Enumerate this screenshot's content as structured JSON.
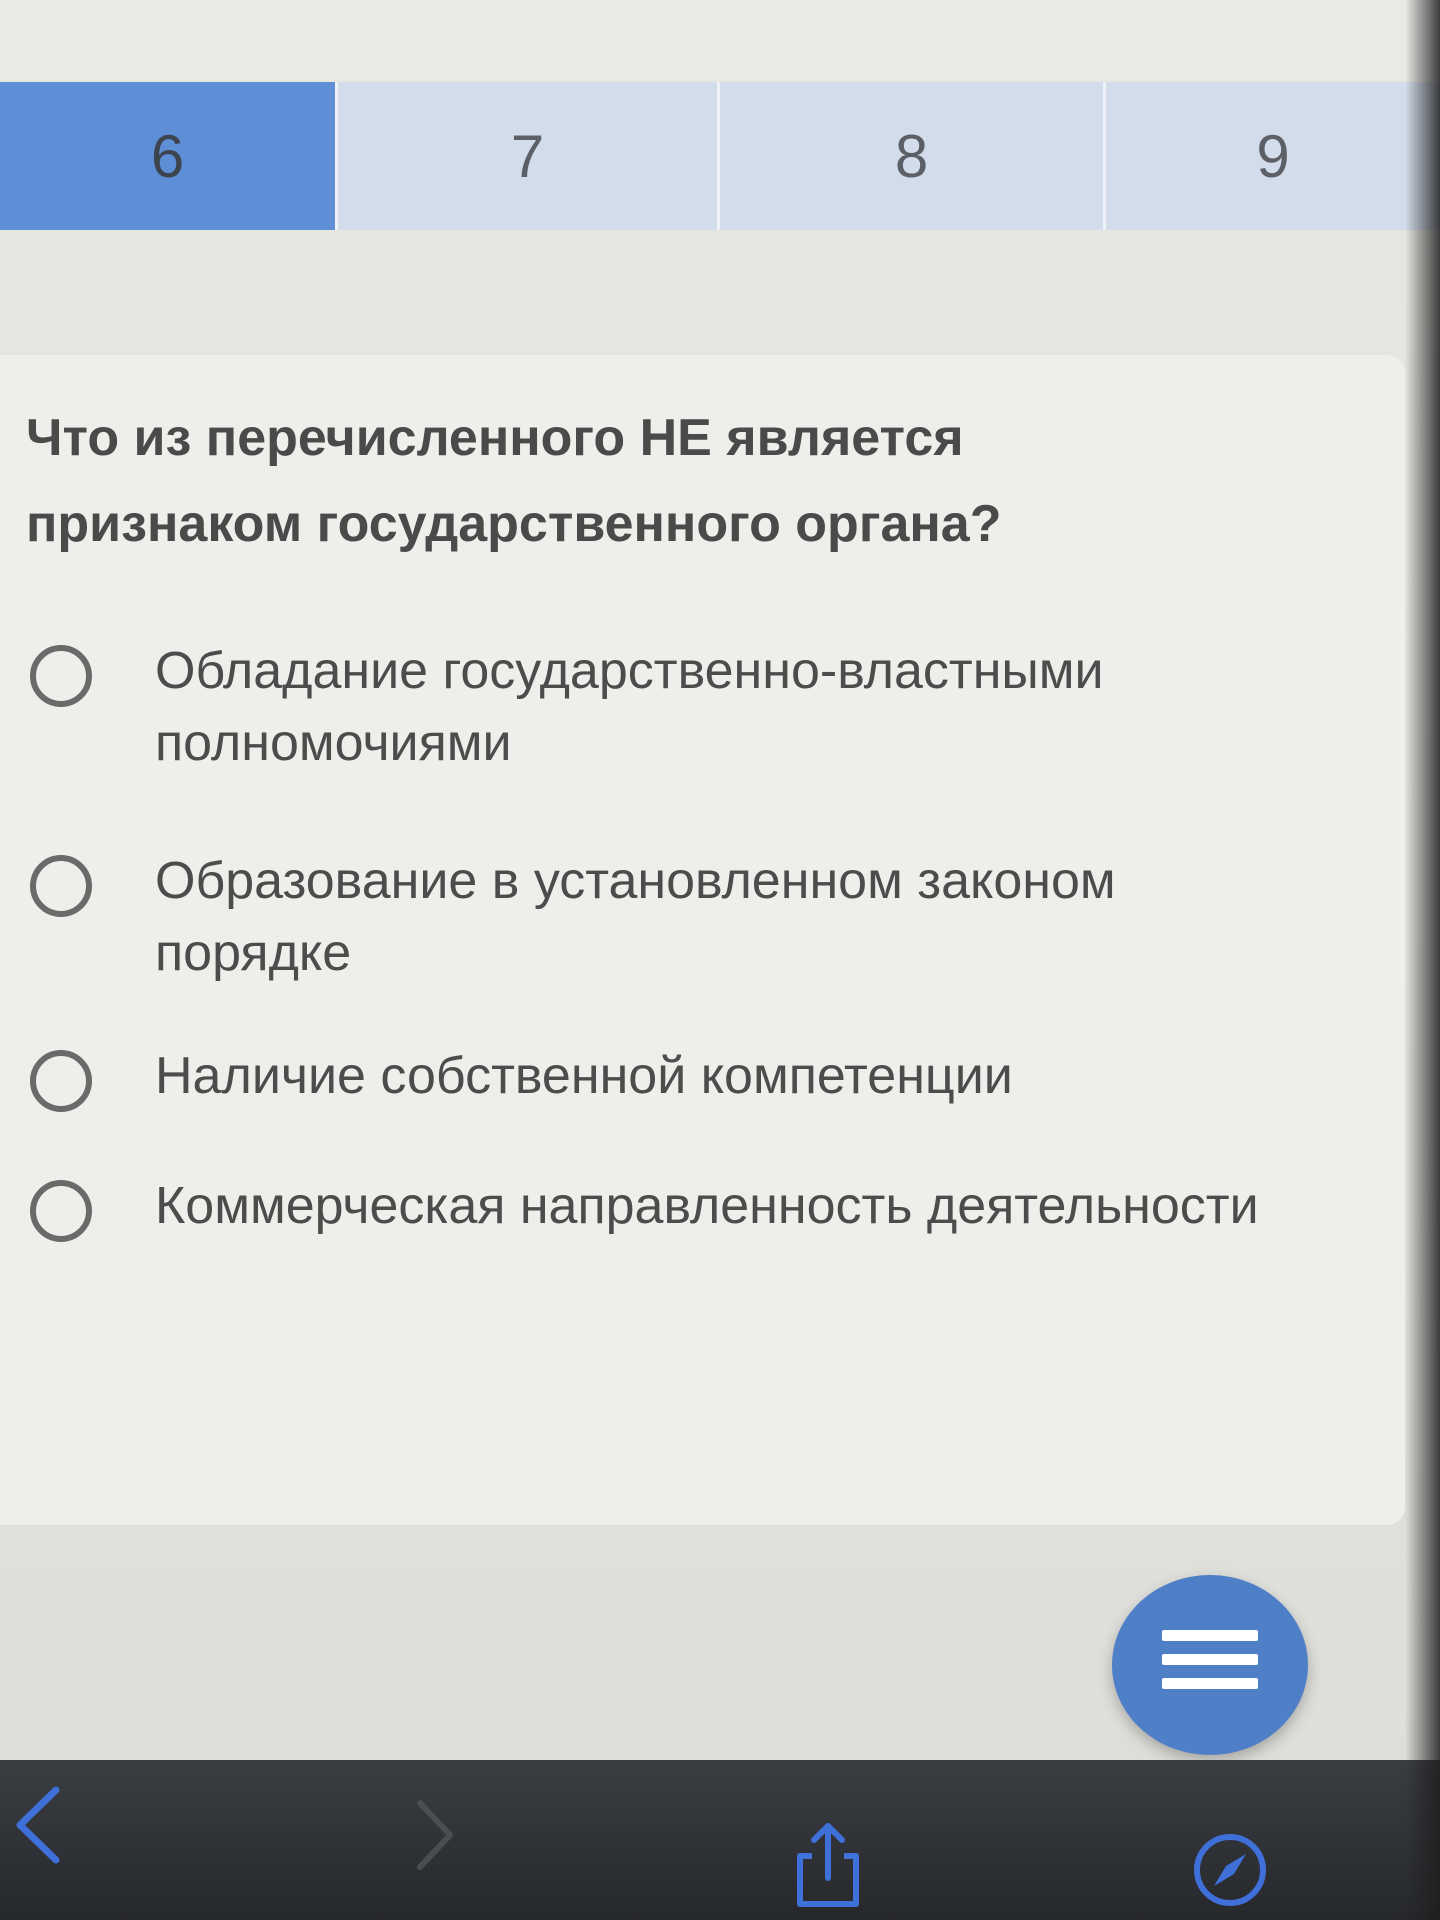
{
  "tabs": [
    {
      "label": "6",
      "active": true
    },
    {
      "label": "7",
      "active": false
    },
    {
      "label": "8",
      "active": false
    },
    {
      "label": "9",
      "active": false
    }
  ],
  "question": {
    "text": "Что из перечисленного НЕ является признаком государственного органа?"
  },
  "options": [
    {
      "label": "Обладание государственно-властными полномочиями"
    },
    {
      "label": "Образование в установленном законом порядке"
    },
    {
      "label": "Наличие собственной компетенции"
    },
    {
      "label": "Коммерческая направленность деятельности"
    }
  ],
  "colors": {
    "active_tab": "#5e8fd6",
    "inactive_tab": "#d3dcea",
    "fab": "#4f7fc7",
    "accent_icon": "#3f6fd8"
  },
  "icons": {
    "fab": "menu-icon",
    "back": "chevron-left-icon",
    "forward": "chevron-right-icon",
    "share": "share-icon",
    "browser": "compass-icon"
  }
}
